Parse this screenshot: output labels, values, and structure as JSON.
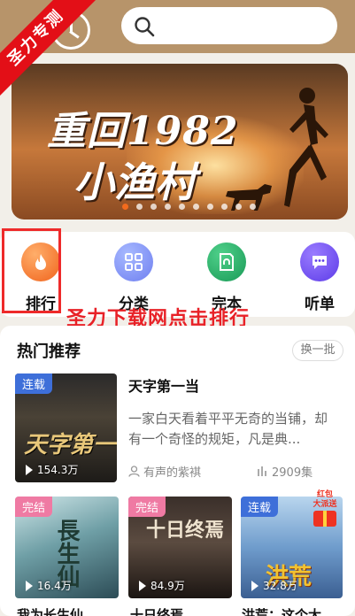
{
  "watermark": {
    "ribbon_text": "圣力专测",
    "annotation_text": "圣力下载网点击排行"
  },
  "header": {
    "icons": [
      "clock-icon",
      "search-icon"
    ]
  },
  "banner": {
    "title_line1": "重回1982",
    "title_line2": "小渔村",
    "dot_count": 10,
    "active_dot": 0
  },
  "categories": [
    {
      "label": "排行",
      "icon": "flame-icon",
      "color": "#f0631c"
    },
    {
      "label": "分类",
      "icon": "grid-icon",
      "color": "#6f7ff0"
    },
    {
      "label": "完本",
      "icon": "book-icon",
      "color": "#1a9a57"
    },
    {
      "label": "听单",
      "icon": "chat-icon",
      "color": "#5d3ce8"
    }
  ],
  "hot": {
    "title": "热门推荐",
    "swap_label": "换一批",
    "featured": {
      "tag": "连载",
      "cover_text": "天字第一",
      "views": "154.3万",
      "title": "天字第一当",
      "description": "一家白天看着平平无奇的当铺，却有一个奇怪的规矩，凡是典...",
      "narrator": "有声的紫褀",
      "episodes": "2909集"
    },
    "books": [
      {
        "tag": "完结",
        "cover_text": "長生仙",
        "views": "16.4万",
        "title": "我为长生仙"
      },
      {
        "tag": "完结",
        "cover_text": "十日终焉",
        "views": "84.9万",
        "title": "十日终焉"
      },
      {
        "tag": "连载",
        "cover_text": "洪荒",
        "views": "32.8万",
        "title": "洪荒：这个大"
      }
    ],
    "gift_badge": "红包\n大派送"
  }
}
